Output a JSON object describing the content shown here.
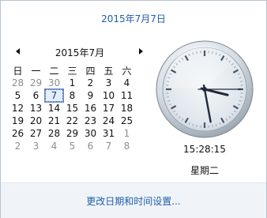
{
  "header": {
    "date_title": "2015年7月7日"
  },
  "calendar": {
    "month_label": "2015年7月",
    "weekdays": [
      "日",
      "一",
      "二",
      "三",
      "四",
      "五",
      "六"
    ],
    "weeks": [
      [
        "28",
        "29",
        "30",
        "1",
        "2",
        "3",
        "4"
      ],
      [
        "5",
        "6",
        "7",
        "8",
        "9",
        "10",
        "11"
      ],
      [
        "12",
        "13",
        "14",
        "15",
        "16",
        "17",
        "18"
      ],
      [
        "19",
        "20",
        "21",
        "22",
        "23",
        "24",
        "25"
      ],
      [
        "26",
        "27",
        "28",
        "29",
        "30",
        "31",
        "1"
      ],
      [
        "2",
        "3",
        "4",
        "5",
        "6",
        "7",
        "8"
      ]
    ],
    "today": "7"
  },
  "clock": {
    "time": "15:28:15",
    "weekday": "星期二",
    "hour": 15,
    "minute": 28,
    "second": 15
  },
  "footer": {
    "settings_link": "更改日期和时间设置..."
  },
  "colors": {
    "link": "#1e5fa8",
    "footer_bg": "#f0f4f9",
    "other_month": "#8e8e8e"
  }
}
